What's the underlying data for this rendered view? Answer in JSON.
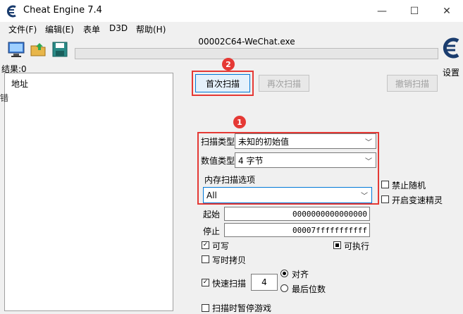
{
  "window": {
    "title": "Cheat Engine 7.4",
    "minimize": "—",
    "maximize": "☐",
    "close": "✕"
  },
  "menu": [
    "文件(F)",
    "编辑(E)",
    "表单",
    "D3D",
    "帮助(H)"
  ],
  "process": {
    "name": "00002C64-WeChat.exe"
  },
  "settings_label": "设置",
  "results": {
    "label": "结果:0"
  },
  "address_list": {
    "column": "地址"
  },
  "left_edge": "错",
  "buttons": {
    "first_scan": "首次扫描",
    "next_scan": "再次扫描",
    "undo_scan": "撤销扫描"
  },
  "badges": {
    "one": "1",
    "two": "2"
  },
  "scan_type": {
    "label": "扫描类型",
    "value": "未知的初始值"
  },
  "value_type": {
    "label": "数值类型",
    "value": "4 字节"
  },
  "memory": {
    "label": "内存扫描选项",
    "region": "All"
  },
  "range": {
    "start_label": "起始",
    "start": "0000000000000000",
    "stop_label": "停止",
    "stop": "00007fffffffffff"
  },
  "options": {
    "writable": "可写",
    "executable": "可执行",
    "copy_on_write": "写时拷贝",
    "fast_scan": "快速扫描",
    "fast_scan_value": "4",
    "align": "对齐",
    "last_digits": "最后位数",
    "pause_game": "扫描时暂停游戏",
    "disable_random": "禁止随机",
    "enable_speedhack": "开启变速精灵"
  },
  "colors": {
    "annotation_red": "#e53935",
    "accent_blue": "#0078d7"
  }
}
